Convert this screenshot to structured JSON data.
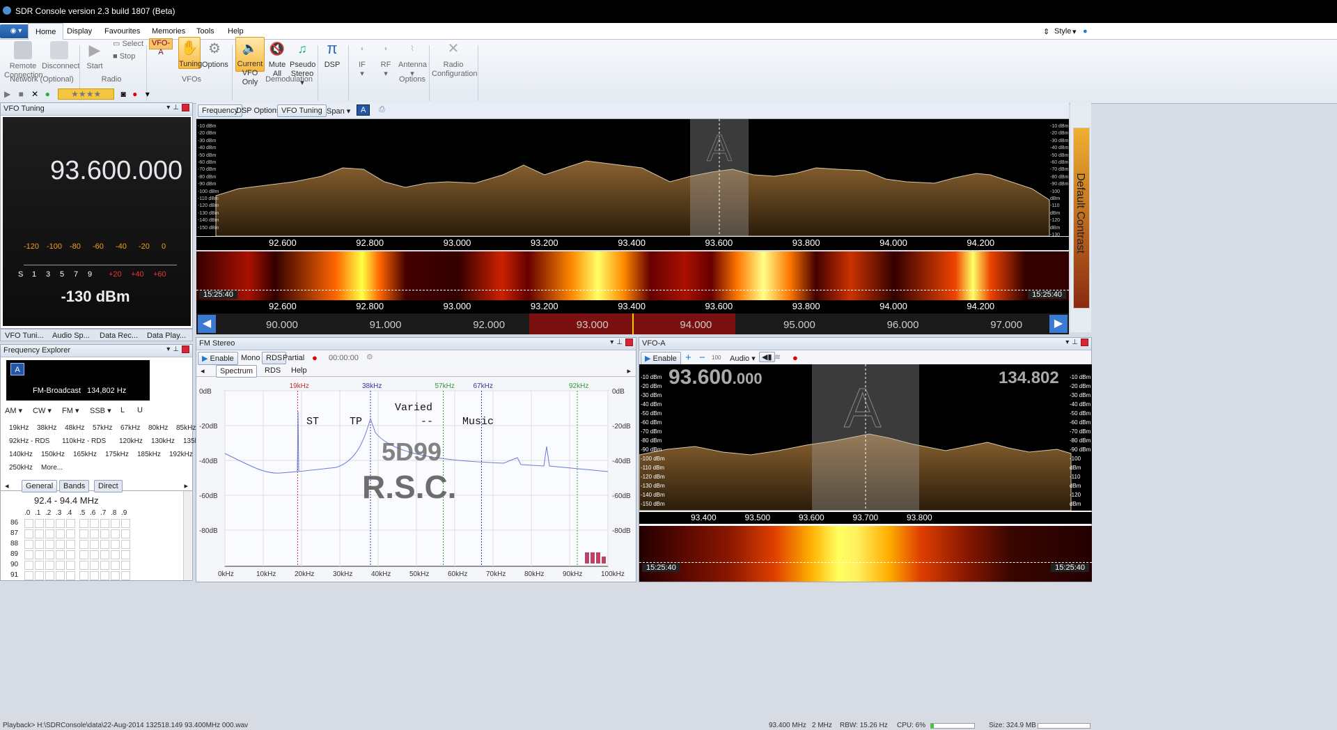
{
  "window": {
    "title": "SDR Console version 2.3 build 1807 (Beta)"
  },
  "menu": {
    "tabs": [
      "Home",
      "Display",
      "Favourites",
      "Memories",
      "Tools",
      "Help"
    ],
    "style": "Style"
  },
  "ribbon": {
    "buttons": [
      {
        "id": "remote",
        "l1": "Remote",
        "l2": "Connection"
      },
      {
        "id": "disconnect",
        "l1": "Disconnect",
        "l2": ""
      },
      {
        "id": "start",
        "l1": "Start",
        "l2": ""
      },
      {
        "id": "select",
        "l1": "Select",
        "l2": ""
      },
      {
        "id": "stop",
        "l1": "Stop",
        "l2": ""
      },
      {
        "id": "vfoa",
        "l1": "VFO-A",
        "l2": ""
      },
      {
        "id": "tuning",
        "l1": "Tuning",
        "l2": ""
      },
      {
        "id": "options",
        "l1": "Options",
        "l2": ""
      },
      {
        "id": "current",
        "l1": "Current",
        "l2": "VFO Only"
      },
      {
        "id": "mute",
        "l1": "Mute",
        "l2": "All"
      },
      {
        "id": "pseudo",
        "l1": "Pseudo",
        "l2": "Stereo ▾"
      },
      {
        "id": "dsp",
        "l1": "DSP",
        "l2": ""
      },
      {
        "id": "if",
        "l1": "IF",
        "l2": "▾"
      },
      {
        "id": "rf",
        "l1": "RF",
        "l2": "▾"
      },
      {
        "id": "antenna",
        "l1": "Antenna",
        "l2": "▾"
      },
      {
        "id": "radioconf",
        "l1": "Radio",
        "l2": "Configuration"
      }
    ],
    "groups": [
      "Network (Optional)",
      "Radio",
      "VFOs",
      "Demodulation",
      "Options"
    ]
  },
  "vfo_tuning": {
    "title": "VFO Tuning",
    "frequency": "93.600.000",
    "scale_top": [
      "-120",
      "-100",
      "-80",
      "-60",
      "-40",
      "-20",
      "0"
    ],
    "scale_s": [
      "S",
      "1",
      "3",
      "5",
      "7",
      "9"
    ],
    "scale_plus": [
      "+20",
      "+40",
      "+60"
    ],
    "signal": "-130 dBm",
    "tabs": [
      "VFO Tuni...",
      "Audio Sp...",
      "Data Rec...",
      "Data Play..."
    ]
  },
  "main_toolbar": {
    "frequency": "Frequency",
    "dsp_options": "DSP Options",
    "vfo_tuning": "VFO Tuning",
    "span": "Span ▾",
    "a": "A"
  },
  "main_spectrum": {
    "db_labels": [
      "-10 dBm",
      "-20 dBm",
      "-30 dBm",
      "-40 dBm",
      "-50 dBm",
      "-60 dBm",
      "-70 dBm",
      "-80 dBm",
      "-90 dBm",
      "-100 dBm",
      "-110 dBm",
      "-120 dBm",
      "-130 dBm",
      "-140 dBm",
      "-150 dBm"
    ],
    "freq_labels": [
      "92.600",
      "92.800",
      "93.000",
      "93.200",
      "93.400",
      "93.600",
      "93.800",
      "94.000",
      "94.200"
    ],
    "time": "15:25:40",
    "band_labels": [
      "90.000",
      "91.000",
      "92.000",
      "93.000",
      "94.000",
      "95.000",
      "96.000",
      "97.000"
    ],
    "contrast": "Default Contrast",
    "vfo_letter": "A"
  },
  "freq_explorer": {
    "title": "Frequency Explorer",
    "name": "FM-Broadcast",
    "value": "134,802 Hz",
    "modes": [
      "AM ▾",
      "CW ▾",
      "FM ▾",
      "SSB ▾",
      "L",
      "U"
    ],
    "links": [
      [
        "19kHz",
        "38kHz",
        "48kHz",
        "57kHz",
        "67kHz",
        "80kHz",
        "85kHz"
      ],
      [
        "92kHz - RDS",
        "110kHz - RDS",
        "120kHz",
        "130kHz",
        "135kHz"
      ],
      [
        "140kHz",
        "150kHz",
        "165kHz",
        "175kHz",
        "185kHz",
        "192kHz"
      ],
      [
        "250kHz",
        "More..."
      ]
    ],
    "tabs": [
      "General",
      "Bands",
      "Direct"
    ],
    "range": "92.4 - 94.4 MHz",
    "cols": [
      ".0",
      ".1",
      ".2",
      ".3",
      ".4",
      ".5",
      ".6",
      ".7",
      ".8",
      ".9"
    ],
    "rows": [
      "86",
      "87",
      "88",
      "89",
      "90",
      "91"
    ]
  },
  "fm_stereo": {
    "title": "FM Stereo",
    "enable": "Enable",
    "mono": "Mono",
    "rds": "RDS",
    "partial": "Partial",
    "time": "00:00:00",
    "tabs": [
      "Spectrum",
      "RDS",
      "Help"
    ],
    "db": [
      "0dB",
      "-20dB",
      "-40dB",
      "-60dB",
      "-80dB"
    ],
    "x": [
      "0kHz",
      "10kHz",
      "20kHz",
      "30kHz",
      "40kHz",
      "50kHz",
      "60kHz",
      "70kHz",
      "80kHz",
      "90kHz",
      "100kHz"
    ],
    "markers": [
      "19kHz",
      "38kHz",
      "57kHz",
      "67kHz",
      "92kHz"
    ],
    "rds_text": {
      "st": "ST",
      "tp": "TP",
      "varied": "Varied",
      "dash": "--",
      "music": "Music",
      "pi": "5D99",
      "ps": "R.S.C."
    }
  },
  "vfo_a": {
    "title": "VFO-A",
    "enable": "Enable",
    "audio": "Audio ▾",
    "hundred": "100",
    "freq_main": "93.600",
    "freq_small": ".000",
    "offset": "134.802",
    "db": [
      "-10 dBm",
      "-20 dBm",
      "-30 dBm",
      "-40 dBm",
      "-50 dBm",
      "-60 dBm",
      "-70 dBm",
      "-80 dBm",
      "-90 dBm",
      "-100 dBm",
      "-110 dBm",
      "-120 dBm",
      "-130 dBm",
      "-140 dBm",
      "-150 dBm"
    ],
    "freq_labels": [
      "93.400",
      "93.500",
      "93.600",
      "93.700",
      "93.800"
    ],
    "time": "15:25:40",
    "letter": "A"
  },
  "status": {
    "path": "Playback> H:\\SDRConsole\\data\\22-Aug-2014 132518.149 93.400MHz 000.wav",
    "freq": "93.400 MHz",
    "bw": "2 MHz",
    "rbw": "RBW: 15.26 Hz",
    "cpu": "CPU: 6%",
    "size": "Size: 324.9 MB"
  },
  "colors": {
    "accent": "#1e56a0",
    "spectrum_fill": "#6b4a22",
    "waterfall_hot": "#ffee55"
  }
}
